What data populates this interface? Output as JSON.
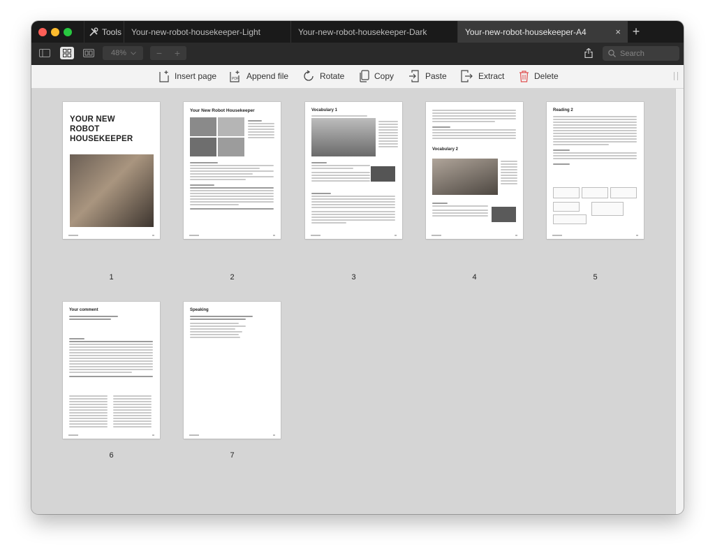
{
  "window": {
    "tools_label": "Tools",
    "tabs": [
      {
        "label": "Your-new-robot-housekeeper-Light"
      },
      {
        "label": "Your-new-robot-housekeeper-Dark"
      },
      {
        "label": "Your-new-robot-housekeeper-A4",
        "active": true
      }
    ],
    "close_glyph": "×",
    "new_tab_glyph": "+"
  },
  "toolbar": {
    "zoom_level": "48%",
    "zoom_out": "−",
    "zoom_in": "+",
    "search_placeholder": "Search"
  },
  "actions": [
    {
      "label": "Insert page",
      "icon": "insert-page-icon"
    },
    {
      "label": "Append file",
      "icon": "append-file-icon"
    },
    {
      "label": "Rotate",
      "icon": "rotate-icon"
    },
    {
      "label": "Copy",
      "icon": "copy-icon"
    },
    {
      "label": "Paste",
      "icon": "paste-icon"
    },
    {
      "label": "Extract",
      "icon": "extract-icon"
    },
    {
      "label": "Delete",
      "icon": "trash-icon",
      "color": "#e05252"
    }
  ],
  "pages": [
    {
      "number": "1",
      "title": "YOUR NEW ROBOT HOUSEKEEPER"
    },
    {
      "number": "2",
      "title": "Your New Robot Housekeeper"
    },
    {
      "number": "3",
      "title": "Vocabulary 1"
    },
    {
      "number": "4",
      "title": "Vocabulary 2"
    },
    {
      "number": "5",
      "title": "Reading 2"
    },
    {
      "number": "6",
      "title": "Your comment"
    },
    {
      "number": "7",
      "title": "Speaking"
    }
  ],
  "colors": {
    "titlebar": "#1a1a1a",
    "toolbar": "#2a2a2a",
    "actionbar": "#f3f3f3",
    "canvas": "#d5d5d5",
    "delete": "#e05252"
  }
}
